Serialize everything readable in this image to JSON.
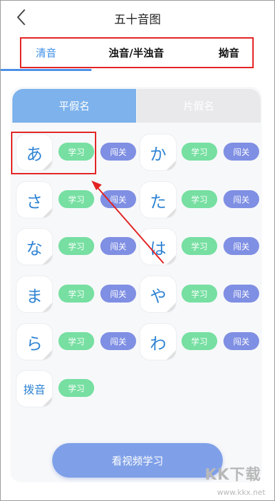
{
  "header": {
    "title": "五十音图"
  },
  "tabs": [
    {
      "label": "清音"
    },
    {
      "label": "浊音/半浊音"
    },
    {
      "label": "拗音"
    }
  ],
  "segmented": {
    "left": "平假名",
    "right": "片假名"
  },
  "kana_grid": [
    {
      "kana": "あ",
      "study": "学习",
      "pass": "闯关"
    },
    {
      "kana": "か",
      "study": "学习",
      "pass": "闯关"
    },
    {
      "kana": "さ",
      "study": "学习",
      "pass": "闯关"
    },
    {
      "kana": "た",
      "study": "学习",
      "pass": "闯关"
    },
    {
      "kana": "な",
      "study": "学习",
      "pass": "闯关"
    },
    {
      "kana": "は",
      "study": "学习",
      "pass": "闯关"
    },
    {
      "kana": "ま",
      "study": "学习",
      "pass": "闯关"
    },
    {
      "kana": "や",
      "study": "学习",
      "pass": "闯关"
    },
    {
      "kana": "ら",
      "study": "学习",
      "pass": "闯关"
    },
    {
      "kana": "わ",
      "study": "学习",
      "pass": "闯关"
    },
    {
      "kana": "拨音",
      "study": "学习"
    }
  ],
  "bottom": {
    "video_button": "看视频学习"
  },
  "watermark": {
    "logo": "KK下载",
    "url": "www.kkx.net"
  },
  "colors": {
    "accent_blue": "#3e8ee8",
    "study_green": "#76dfa1",
    "pass_purple": "#7f8fe3",
    "annotation_red": "#e32222"
  }
}
